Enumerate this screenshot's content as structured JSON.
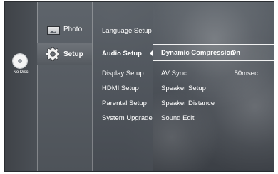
{
  "left_panel": {
    "disc_status": "No Disc",
    "disc_icon": "disc-icon"
  },
  "main_menu": [
    {
      "label": "Photo",
      "icon": "photo-icon"
    },
    {
      "label": "Setup",
      "icon": "gear-icon",
      "selected": true
    }
  ],
  "submenu": [
    {
      "label": "Language Setup"
    },
    {
      "label": "Audio Setup",
      "selected": true
    },
    {
      "label": "Display Setup"
    },
    {
      "label": "HDMI Setup"
    },
    {
      "label": "Parental Setup"
    },
    {
      "label": "System Upgrade"
    }
  ],
  "options": [
    {
      "label": "Dynamic Compression",
      "separator": ":",
      "value": "On",
      "highlighted": true
    },
    {
      "label": "AV Sync",
      "separator": ":",
      "value": "50msec"
    },
    {
      "label": "Speaker Setup"
    },
    {
      "label": "Speaker Distance"
    },
    {
      "label": "Sound Edit"
    }
  ],
  "colors": {
    "background": "#4a4f55",
    "text": "#ffffff",
    "highlight_border": "#f2f2f2"
  }
}
